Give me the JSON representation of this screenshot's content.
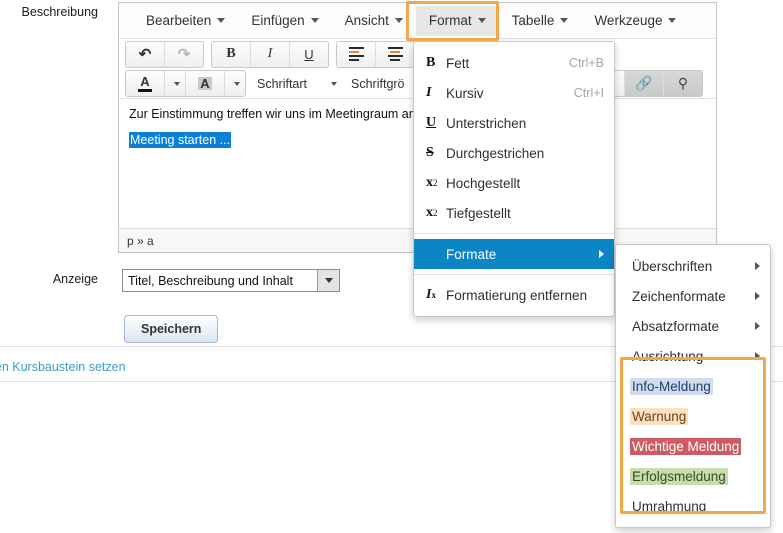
{
  "form": {
    "label_beschreibung": "Beschreibung",
    "label_anzeige": "Anzeige",
    "anzeige_value": "Titel, Beschreibung und Inhalt",
    "save_label": "Speichern",
    "footer_link": "f diesen Kursbaustein setzen"
  },
  "editor": {
    "menubar": [
      {
        "label": "Bearbeiten",
        "active": false
      },
      {
        "label": "Einfügen",
        "active": false
      },
      {
        "label": "Ansicht",
        "active": false
      },
      {
        "label": "Format",
        "active": true
      },
      {
        "label": "Tabelle",
        "active": false
      },
      {
        "label": "Werkzeuge",
        "active": false
      }
    ],
    "toolbar_row2": {
      "font_family_label": "Schriftart",
      "font_size_label": "Schriftgrö"
    },
    "content": {
      "paragraph": "Zur Einstimmung treffen wir uns im Meetingraum an",
      "selected_link": "Meeting starten ..."
    },
    "statusbar_path": "p » a"
  },
  "format_menu": {
    "items": [
      {
        "icon": "bold-icon",
        "glyph": "B",
        "label": "Fett",
        "accel": "Ctrl+B"
      },
      {
        "icon": "italic-icon",
        "glyph": "I",
        "label": "Kursiv",
        "accel": "Ctrl+I"
      },
      {
        "icon": "underline-icon",
        "glyph": "U",
        "label": "Unterstrichen",
        "accel": ""
      },
      {
        "icon": "strikethrough-icon",
        "glyph": "S",
        "label": "Durchgestrichen",
        "accel": ""
      },
      {
        "icon": "superscript-icon",
        "glyph": "x",
        "label": "Hochgestellt",
        "accel": ""
      },
      {
        "icon": "subscript-icon",
        "glyph": "x",
        "label": "Tiefgestellt",
        "accel": ""
      },
      {
        "icon": "formats-icon",
        "glyph": "",
        "label": "Formate",
        "accel": "",
        "selected": true,
        "submenu": true
      },
      {
        "icon": "remove-format-icon",
        "glyph": "I",
        "label": "Formatierung entfernen",
        "accel": ""
      }
    ]
  },
  "formate_submenu": {
    "items": [
      {
        "label": "Überschriften",
        "submenu": true,
        "bg": "",
        "fg": ""
      },
      {
        "label": "Zeichenformate",
        "submenu": true,
        "bg": "",
        "fg": ""
      },
      {
        "label": "Absatzformate",
        "submenu": true,
        "bg": "",
        "fg": ""
      },
      {
        "label": "Ausrichtung",
        "submenu": true,
        "bg": "",
        "fg": ""
      },
      {
        "label": "Info-Meldung",
        "submenu": false,
        "bg": "#d3dced",
        "fg": "#1c3f6e"
      },
      {
        "label": "Warnung",
        "submenu": false,
        "bg": "#fbe0c2",
        "fg": "#6b4614"
      },
      {
        "label": "Wichtige Meldung",
        "submenu": false,
        "bg": "#cc5b62",
        "fg": "#ffffff"
      },
      {
        "label": "Erfolgsmeldung",
        "submenu": false,
        "bg": "#c9dcae",
        "fg": "#33501c"
      },
      {
        "label": "Umrahmung",
        "submenu": false,
        "bg": "",
        "fg": ""
      }
    ]
  },
  "annotations": {
    "highlight_color": "#f2a74b",
    "format_button_box": "format-menu-button",
    "submenu_box": "custom-formats-group"
  }
}
